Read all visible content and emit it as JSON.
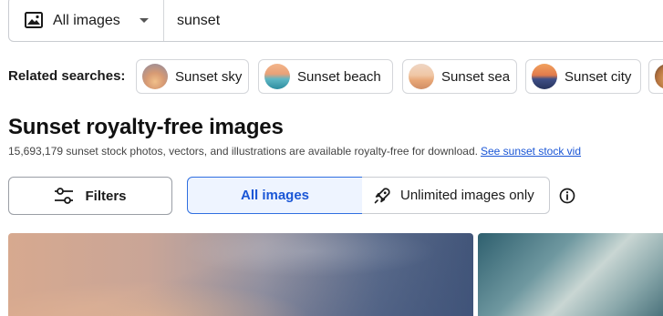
{
  "search": {
    "type_selector_label": "All images",
    "query": "sunset"
  },
  "related": {
    "label": "Related searches:",
    "chips": [
      {
        "label": "Sunset sky"
      },
      {
        "label": "Sunset beach"
      },
      {
        "label": "Sunset sea"
      },
      {
        "label": "Sunset city"
      }
    ]
  },
  "heading": {
    "title": "Sunset royalty-free images",
    "description": "15,693,179 sunset stock photos, vectors, and illustrations are available royalty-free for download.",
    "link_text": "See sunset stock vid"
  },
  "filters": {
    "filters_label": "Filters",
    "all_images_label": "All images",
    "unlimited_label": "Unlimited images only"
  },
  "icons": {
    "image_type": "image-icon",
    "dropdown": "chevron-down-icon",
    "filters": "sliders-icon",
    "unlimited": "rocket-icon",
    "info": "info-icon"
  },
  "colors": {
    "accent": "#1a56d6",
    "selected_bg": "#eef4ff",
    "border": "#c9ccd1"
  }
}
